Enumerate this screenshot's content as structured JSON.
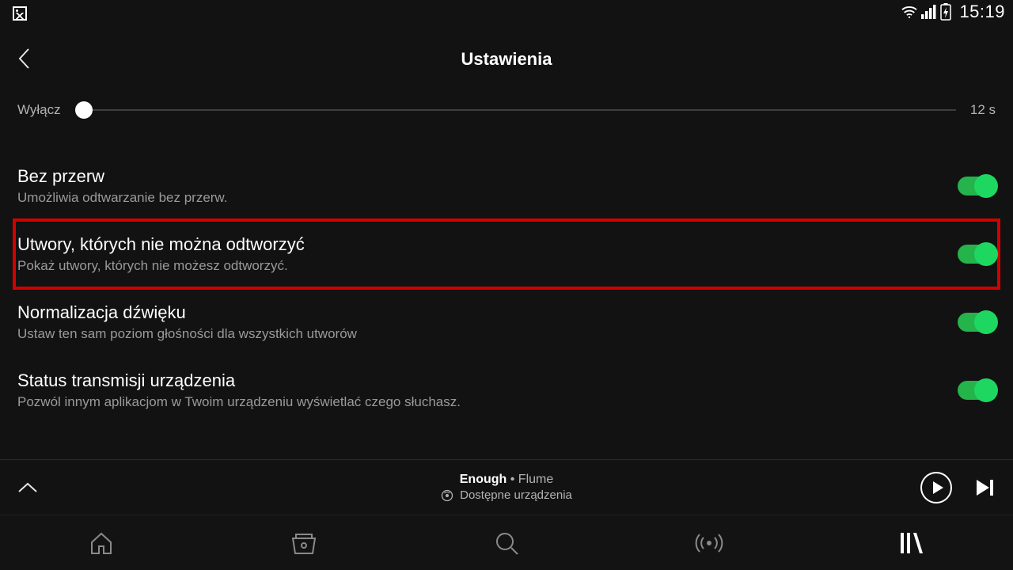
{
  "status": {
    "clock": "15:19"
  },
  "header": {
    "title": "Ustawienia"
  },
  "slider": {
    "off_label": "Wyłącz",
    "value_label": "12 s"
  },
  "settings": [
    {
      "title": "Bez przerw",
      "sub": "Umożliwia odtwarzanie bez przerw.",
      "on": true,
      "highlight": false
    },
    {
      "title": "Utwory, których nie można odtworzyć",
      "sub": "Pokaż utwory, których nie możesz odtworzyć.",
      "on": true,
      "highlight": true
    },
    {
      "title": "Normalizacja dźwięku",
      "sub": "Ustaw ten sam poziom głośności dla wszystkich utworów",
      "on": true,
      "highlight": false
    },
    {
      "title": "Status transmisji urządzenia",
      "sub": "Pozwól innym aplikacjom w Twoim urządzeniu wyświetlać czego słuchasz.",
      "on": true,
      "highlight": false
    }
  ],
  "now_playing": {
    "track": "Enough",
    "sep": " • ",
    "artist": "Flume",
    "devices_label": "Dostępne urządzenia"
  }
}
